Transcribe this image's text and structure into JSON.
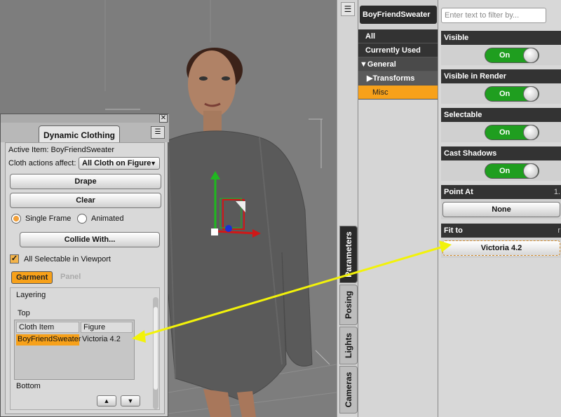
{
  "dynamic_clothing": {
    "tab_label": "Dynamic Clothing",
    "active_item_label": "Active Item: BoyFriendSweater",
    "cloth_actions_label": "Cloth actions affect:",
    "cloth_actions_value": "All Cloth on Figure",
    "drape_label": "Drape",
    "clear_label": "Clear",
    "single_frame_label": "Single Frame",
    "animated_label": "Animated",
    "collide_label": "Collide With...",
    "all_selectable_label": "All Selectable in Viewport",
    "garment_tab": "Garment",
    "panel_tab": "Panel",
    "layering": {
      "title": "Layering",
      "top_label": "Top",
      "bottom_label": "Bottom",
      "columns": [
        "Cloth Item",
        "Figure"
      ],
      "rows": [
        [
          "BoyFriendSweater",
          "Victoria 4.2"
        ]
      ]
    }
  },
  "side_tabs": [
    "Parameters",
    "Posing",
    "Lights",
    "Cameras"
  ],
  "tree": {
    "title": "BoyFriendSweater",
    "items": [
      {
        "label": "All"
      },
      {
        "label": "Currently Used"
      },
      {
        "label": "General"
      },
      {
        "label": "Transforms"
      },
      {
        "label": "Misc"
      }
    ]
  },
  "params": {
    "filter_placeholder": "Enter text to filter by...",
    "visible": {
      "label": "Visible",
      "value": "On"
    },
    "visible_render": {
      "label": "Visible in Render",
      "value": "On"
    },
    "selectable": {
      "label": "Selectable",
      "value": "On"
    },
    "cast_shadows": {
      "label": "Cast Shadows",
      "value": "On"
    },
    "point_at": {
      "label": "Point At",
      "value": "None",
      "extra": "1."
    },
    "fit_to": {
      "label": "Fit to",
      "value": "Victoria 4.2",
      "extra": "r"
    }
  },
  "colors": {
    "accent": "#f7a11a",
    "toggle_on": "#1f9e1f",
    "arrow": "#f2f20a"
  }
}
